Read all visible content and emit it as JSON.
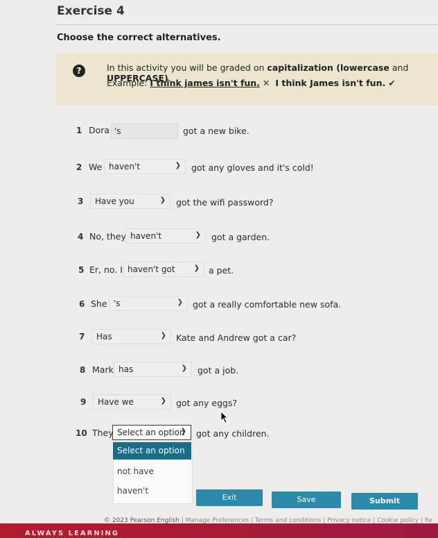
{
  "title": "Exercise 4",
  "instructions": "Choose the correct alternatives.",
  "info": {
    "line1_a": "In this activity you will be graded on ",
    "line1_b": "capitalization (lowercase",
    "line1_c": " and ",
    "line1_d": "UPPERCASE)",
    "line1_e": ".",
    "example_label": "Example: ",
    "example_wrong": "I think james isn't fun.",
    "example_wrong_mark": "✕",
    "example_right": "I think James isn't fun.",
    "example_right_mark": "✔"
  },
  "questions": [
    {
      "num": "1",
      "pre": "Dora",
      "answer": "'s",
      "post": "got a new bike."
    },
    {
      "num": "2",
      "pre": "We",
      "answer": "haven't",
      "post": "got any gloves and it's cold!"
    },
    {
      "num": "3",
      "pre": "",
      "answer": "Have you",
      "post": "got the wifi password?"
    },
    {
      "num": "4",
      "pre": "No, they",
      "answer": "haven't",
      "post": "got a garden."
    },
    {
      "num": "5",
      "pre": "Er, no. I",
      "answer": "haven't got",
      "post": "a pet."
    },
    {
      "num": "6",
      "pre": "She",
      "answer": "'s",
      "post": "got a really comfortable new sofa."
    },
    {
      "num": "7",
      "pre": "",
      "answer": "Has",
      "post": "Kate and Andrew got a car?"
    },
    {
      "num": "8",
      "pre": "Mark",
      "answer": "has",
      "post": "got a job."
    },
    {
      "num": "9",
      "pre": "",
      "answer": "Have we",
      "post": "got any eggs?"
    },
    {
      "num": "10",
      "pre": "They",
      "answer": "Select an option",
      "post": "got any children."
    }
  ],
  "dropdown_options": [
    "Select an option",
    "not have",
    "haven't"
  ],
  "buttons": {
    "exit": "Exit",
    "save": "Save",
    "submit": "Submit"
  },
  "footer": {
    "copyright": "© 2023 Pearson English",
    "links": [
      "Manage Preferences",
      "Terms and conditions",
      "Privacy notice",
      "Cookie policy",
      "Re"
    ]
  },
  "brand": "ALWAYS LEARNING"
}
